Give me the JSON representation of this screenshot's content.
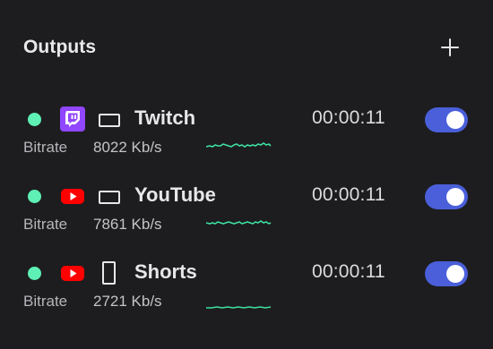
{
  "panel": {
    "title": "Outputs",
    "add_icon": "plus-icon"
  },
  "outputs": [
    {
      "platform": "Twitch",
      "platform_icon": "twitch-icon",
      "aspect_icon": "landscape-screen-icon",
      "time": "00:00:11",
      "enabled": true,
      "bitrate_label": "Bitrate",
      "bitrate_value": "8022 Kb/s",
      "status_color": "#5ef0b4"
    },
    {
      "platform": "YouTube",
      "platform_icon": "youtube-icon",
      "aspect_icon": "landscape-screen-icon",
      "time": "00:00:11",
      "enabled": true,
      "bitrate_label": "Bitrate",
      "bitrate_value": "7861 Kb/s",
      "status_color": "#5ef0b4"
    },
    {
      "platform": "Shorts",
      "platform_icon": "youtube-icon",
      "aspect_icon": "portrait-screen-icon",
      "time": "00:00:11",
      "enabled": true,
      "bitrate_label": "Bitrate",
      "bitrate_value": "2721 Kb/s",
      "status_color": "#5ef0b4"
    }
  ],
  "colors": {
    "background": "#1d1d1f",
    "status_live": "#5ef0b4",
    "toggle_on": "#4a5fd9",
    "twitch": "#9146ff",
    "youtube": "#ff0000",
    "sparkline": "#3ee0a0"
  }
}
